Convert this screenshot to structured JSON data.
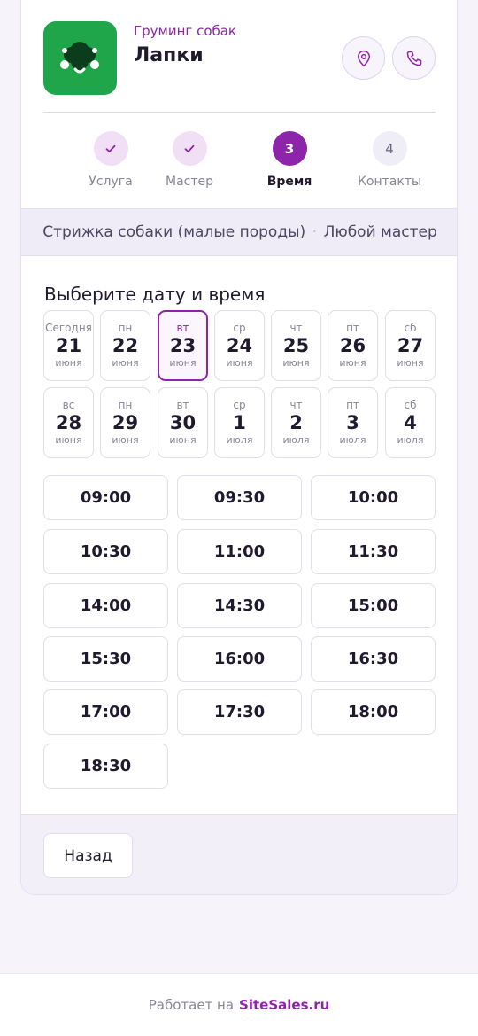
{
  "header": {
    "category": "Груминг собак",
    "title": "Лапки",
    "logo_icon": "paw-dog-icon",
    "location_icon": "map-pin-icon",
    "phone_icon": "phone-icon"
  },
  "steps": [
    {
      "number": "1",
      "label": "Услуга",
      "state": "done"
    },
    {
      "number": "2",
      "label": "Мастер",
      "state": "done"
    },
    {
      "number": "3",
      "label": "Время",
      "state": "active"
    },
    {
      "number": "4",
      "label": "Контакты",
      "state": "todo"
    }
  ],
  "summary": {
    "service": "Стрижка собаки (малые породы)",
    "separator": "·",
    "master": "Любой мастер"
  },
  "picker": {
    "title": "Выберите дату и время",
    "selected_date_index": 2,
    "dates": [
      {
        "dow": "Сегодня",
        "day": "21",
        "month": "июня"
      },
      {
        "dow": "пн",
        "day": "22",
        "month": "июня"
      },
      {
        "dow": "вт",
        "day": "23",
        "month": "июня"
      },
      {
        "dow": "ср",
        "day": "24",
        "month": "июня"
      },
      {
        "dow": "чт",
        "day": "25",
        "month": "июня"
      },
      {
        "dow": "пт",
        "day": "26",
        "month": "июня"
      },
      {
        "dow": "сб",
        "day": "27",
        "month": "июня"
      },
      {
        "dow": "вс",
        "day": "28",
        "month": "июня"
      },
      {
        "dow": "пн",
        "day": "29",
        "month": "июня"
      },
      {
        "dow": "вт",
        "day": "30",
        "month": "июня"
      },
      {
        "dow": "ср",
        "day": "1",
        "month": "июля"
      },
      {
        "dow": "чт",
        "day": "2",
        "month": "июля"
      },
      {
        "dow": "пт",
        "day": "3",
        "month": "июля"
      },
      {
        "dow": "сб",
        "day": "4",
        "month": "июля"
      }
    ],
    "times": [
      "09:00",
      "09:30",
      "10:00",
      "10:30",
      "11:00",
      "11:30",
      "14:00",
      "14:30",
      "15:00",
      "15:30",
      "16:00",
      "16:30",
      "17:00",
      "17:30",
      "18:00",
      "18:30"
    ]
  },
  "actions": {
    "back_label": "Назад"
  },
  "footer": {
    "powered_by": "Работает на",
    "brand": "SiteSales.ru"
  },
  "colors": {
    "accent": "#8e24aa",
    "logo_bg": "#1fa64a"
  }
}
